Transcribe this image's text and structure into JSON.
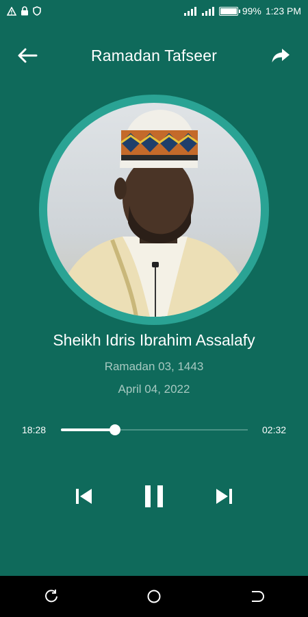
{
  "status_bar": {
    "time": "1:23 PM",
    "battery_percent": "99%",
    "battery_level": 0.99,
    "icons": [
      "warning-icon",
      "lock-icon",
      "shield-icon",
      "signal-icon",
      "signal-icon",
      "battery-icon"
    ]
  },
  "app_bar": {
    "title": "Ramadan Tafseer",
    "back_icon": "arrow-left-icon",
    "share_icon": "share-icon"
  },
  "track": {
    "title": "Sheikh Idris Ibrahim Assalafy",
    "hijri_date": "Ramadan 03, 1443",
    "gregorian_date": "April 04, 2022"
  },
  "player": {
    "elapsed": "18:28",
    "remaining": "02:32",
    "progress": 0.29,
    "controls": [
      "skip-previous-icon",
      "pause-icon",
      "skip-next-icon"
    ]
  },
  "nav_bar": {
    "icons": [
      "recent-apps-icon",
      "home-icon",
      "back-icon"
    ]
  },
  "colors": {
    "background": "#0f6a5b",
    "accent_ring": "#2aa394",
    "subtext": "#a7c9c1"
  }
}
